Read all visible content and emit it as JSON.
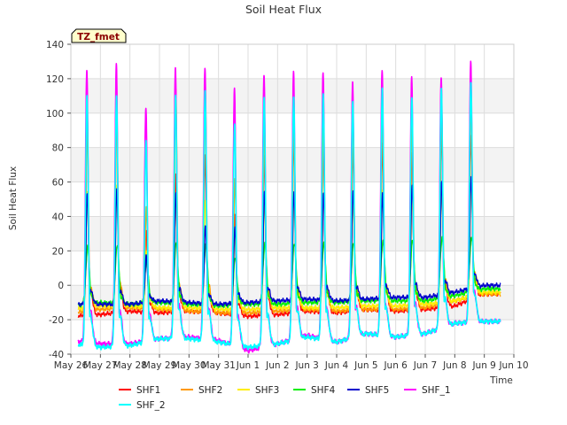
{
  "chart_data": {
    "type": "line",
    "title": "Soil Heat Flux",
    "xlabel": "Time",
    "ylabel": "Soil Heat Flux",
    "ylim": [
      -40,
      140
    ],
    "yticks": [
      -40,
      -20,
      0,
      20,
      40,
      60,
      80,
      100,
      120,
      140
    ],
    "xlim": [
      0,
      15
    ],
    "xtick_labels": [
      "May 26",
      "May 27",
      "May 28",
      "May 29",
      "May 30",
      "May 31",
      "Jun 1",
      "Jun 2",
      "Jun 3",
      "Jun 4",
      "Jun 5",
      "Jun 6",
      "Jun 7",
      "Jun 8",
      "Jun 9",
      "Jun 10"
    ],
    "x_start_label": "May 26",
    "data_x_range": [
      0.25,
      14.55
    ],
    "grid": true,
    "band_shading": true,
    "legend_placement": "bottom",
    "site_label": "TZ_fmet",
    "series": [
      {
        "name": "SHF1",
        "color": "#ff0000",
        "min": [
          -18,
          -17,
          -15,
          -16,
          -15,
          -16,
          -18,
          -17,
          -15,
          -16,
          -14,
          -15,
          -14,
          -12,
          -5
        ],
        "peak": [
          95,
          100,
          32,
          65,
          75,
          42,
          75,
          86,
          84,
          80,
          82,
          78,
          90,
          88
        ]
      },
      {
        "name": "SHF2",
        "color": "#ff9900",
        "min": [
          -16,
          -14,
          -13,
          -14,
          -15,
          -16,
          -16,
          -15,
          -14,
          -15,
          -14,
          -14,
          -13,
          -9,
          -5
        ],
        "peak": [
          100,
          105,
          45,
          115,
          112,
          62,
          90,
          95,
          92,
          96,
          100,
          98,
          105,
          108
        ]
      },
      {
        "name": "SHF3",
        "color": "#ffee00",
        "min": [
          -14,
          -12,
          -12,
          -13,
          -13,
          -14,
          -14,
          -13,
          -13,
          -13,
          -12,
          -12,
          -11,
          -9,
          -4
        ],
        "peak": [
          55,
          58,
          20,
          52,
          50,
          30,
          50,
          52,
          52,
          50,
          55,
          52,
          58,
          60
        ]
      },
      {
        "name": "SHF4",
        "color": "#00ee00",
        "min": [
          -12,
          -10,
          -11,
          -10,
          -11,
          -12,
          -11,
          -11,
          -10,
          -10,
          -9,
          -9,
          -9,
          -6,
          -2
        ],
        "peak": [
          22,
          24,
          14,
          25,
          24,
          16,
          24,
          25,
          24,
          25,
          26,
          26,
          28,
          28
        ]
      },
      {
        "name": "SHF5",
        "color": "#0000cc",
        "min": [
          -11,
          -11,
          -11,
          -9,
          -10,
          -11,
          -10,
          -9,
          -8,
          -9,
          -8,
          -7,
          -7,
          -4,
          0
        ],
        "peak": [
          53,
          56,
          18,
          53,
          35,
          34,
          54,
          55,
          53,
          55,
          54,
          58,
          60,
          64
        ]
      },
      {
        "name": "SHF_1",
        "color": "#ff00ff",
        "min": [
          -32,
          -34,
          -34,
          -31,
          -30,
          -32,
          -38,
          -34,
          -29,
          -33,
          -28,
          -30,
          -28,
          -22,
          -21
        ],
        "peak": [
          125,
          128,
          104,
          125,
          127,
          114,
          122,
          124,
          124,
          117,
          126,
          120,
          121,
          130
        ]
      },
      {
        "name": "SHF_2",
        "color": "#00ffff",
        "min": [
          -34,
          -36,
          -35,
          -31,
          -31,
          -33,
          -36,
          -34,
          -30,
          -33,
          -28,
          -30,
          -28,
          -22,
          -21
        ],
        "peak": [
          110,
          110,
          84,
          111,
          112,
          95,
          108,
          110,
          111,
          107,
          114,
          110,
          113,
          119
        ]
      }
    ]
  }
}
